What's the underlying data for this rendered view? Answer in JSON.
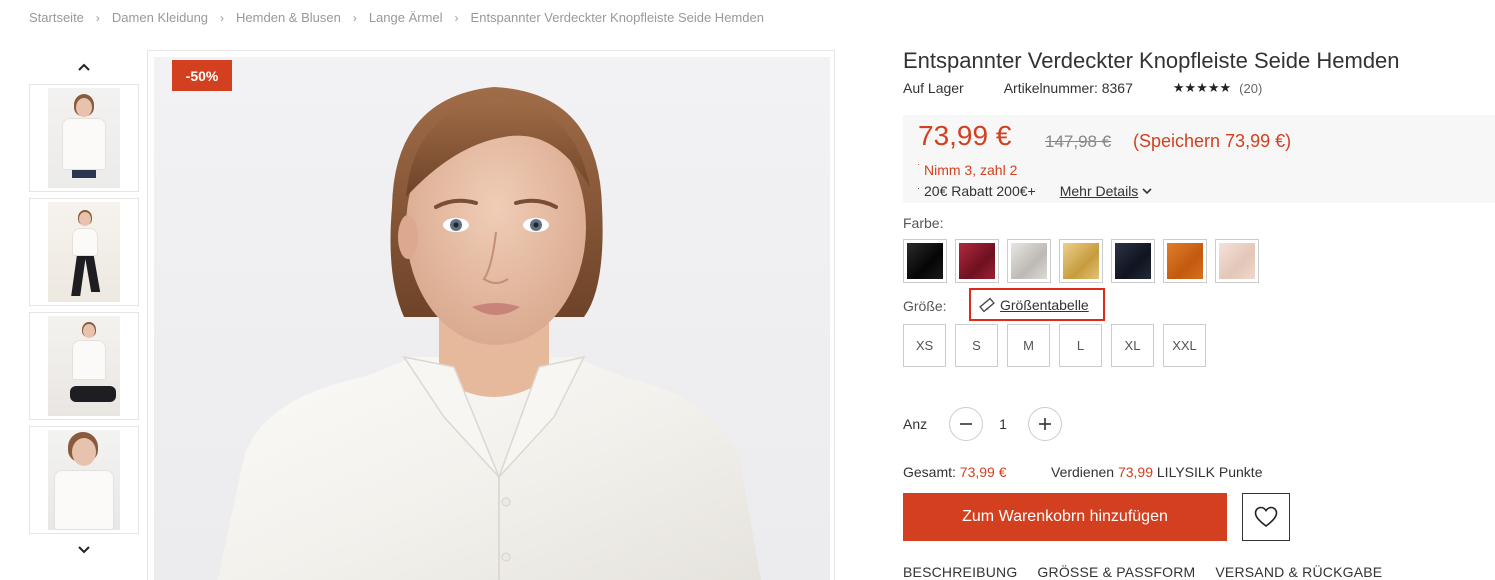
{
  "breadcrumb": [
    {
      "label": "Startseite"
    },
    {
      "label": "Damen Kleidung"
    },
    {
      "label": "Hemden & Blusen"
    },
    {
      "label": "Lange Ärmel"
    },
    {
      "label": "Entspannter Verdeckter Knopfleiste Seide Hemden"
    }
  ],
  "breadcrumb_separator": "›",
  "gallery": {
    "badge": "-50%",
    "thumbnail_count": 4
  },
  "product": {
    "title": "Entspannter Verdeckter Knopfleiste Seide Hemden",
    "stock": "Auf Lager",
    "sku": "Artikelnummer: 8367",
    "stars": "★★★★★",
    "review_count": "(20)"
  },
  "pricing": {
    "price": "73,99 €",
    "old_price": "147,98 €",
    "savings": "(Speichern 73,99 €)",
    "promo1": "Nimm 3, zahl 2",
    "promo2": "20€ Rabatt 200€+",
    "more_details": "Mehr Details",
    "bullet": "·"
  },
  "color": {
    "label": "Farbe:",
    "swatches": [
      {
        "name": "black",
        "hex": "#141414"
      },
      {
        "name": "wine-red",
        "hex": "#8e1d2c"
      },
      {
        "name": "silver-grey",
        "hex": "#d6d3cf"
      },
      {
        "name": "gold",
        "hex": "#d8b45c"
      },
      {
        "name": "navy",
        "hex": "#1d2233"
      },
      {
        "name": "orange",
        "hex": "#d46a1e"
      },
      {
        "name": "light-pink",
        "hex": "#ebd3c7"
      }
    ]
  },
  "size": {
    "label": "Größe:",
    "chart_link": "Größentabelle",
    "options": [
      "XS",
      "S",
      "M",
      "L",
      "XL",
      "XXL"
    ]
  },
  "quantity": {
    "label": "Anz",
    "value": "1"
  },
  "summary": {
    "total_label": "Gesamt:",
    "total_value": "73,99 €",
    "points_prefix": "Verdienen",
    "points_value": "73,99",
    "points_suffix": "LILYSILK Punkte"
  },
  "actions": {
    "add_to_cart": "Zum Warenkobrn hinzufügen"
  },
  "tabs": [
    "BESCHREIBUNG",
    "GRÖSSE & PASSFORM",
    "VERSAND & RÜCKGABE"
  ],
  "colors": {
    "accent": "#d3401f",
    "highlight_border": "#e0281c"
  }
}
